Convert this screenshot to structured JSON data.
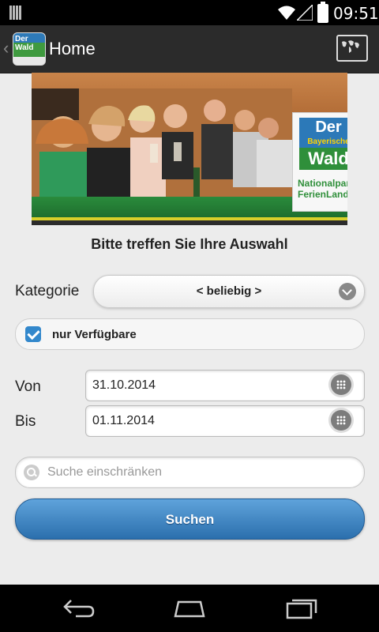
{
  "status": {
    "time": "09:51"
  },
  "actionbar": {
    "title": "Home",
    "app_icon_text": "Der Wald"
  },
  "banner": {
    "logo_der": "Der",
    "logo_bayerische": "Bayerische",
    "logo_wald": "Wald",
    "logo_nationalpark": "Nationalpark",
    "logo_ferienland": "FerienLand"
  },
  "form": {
    "heading": "Bitte treffen Sie Ihre Auswahl",
    "kategorie_label": "Kategorie",
    "kategorie_value": "< beliebig >",
    "available_label": "nur Verfügbare",
    "available_checked": true,
    "von_label": "Von",
    "von_value": "31.10.2014",
    "bis_label": "Bis",
    "bis_value": "01.11.2014",
    "search_placeholder": "Suche einschränken",
    "submit_label": "Suchen"
  },
  "colors": {
    "accent": "#3388cc",
    "button_top": "#5fa3db",
    "button_bottom": "#2b6fad"
  }
}
